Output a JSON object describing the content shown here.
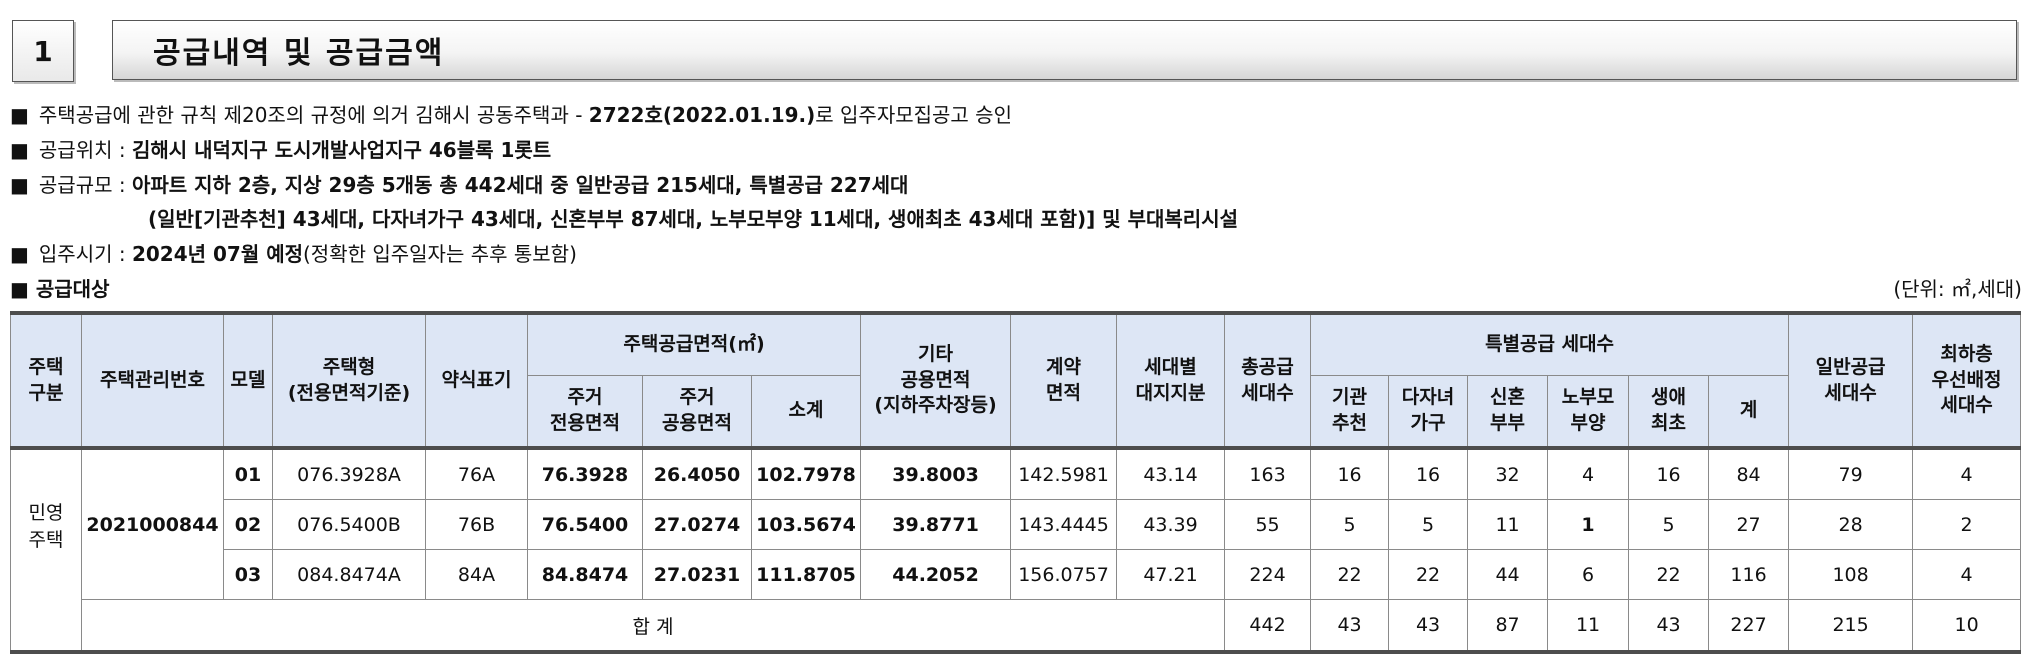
{
  "section": {
    "number": "1",
    "title": "공급내역 및 공급금액"
  },
  "notice": {
    "bullet": "■",
    "approval_prefix": "주택공급에 관한 규칙 제20조의 규정에 의거 김해시 공동주택과 -",
    "approval_no": "2722호(2022.01.19.)",
    "approval_suffix": "로 입주자모집공고 승인",
    "location_label": "공급위치 :",
    "location_value": "김해시 내덕지구 도시개발사업지구 46블록 1롯트",
    "scale_label": "공급규모 :",
    "scale_value": "아파트 지하 2층, 지상 29층 5개동 총 442세대 중 일반공급 215세대, 특별공급 227세대",
    "scale_detail": "(일반[기관추천] 43세대, 다자녀가구 43세대, 신혼부부 87세대, 노부모부양 11세대, 생애최초 43세대 포함)] 및 부대복리시설",
    "movein_label": "입주시기 :",
    "movein_value": "2024년 07월 예정",
    "movein_note": "(정확한 입주일자는 추후 통보함)",
    "target_label": "공급대상",
    "unit": "(단위:  ㎡,세대)"
  },
  "table": {
    "headers": {
      "type": [
        "주택",
        "구분"
      ],
      "mgmt_no": "주택관리번호",
      "model": "모델",
      "house_type": [
        "주택형",
        "(전용면적기준)"
      ],
      "short": "약식표기",
      "area_group": "주택공급면적(㎡)",
      "excl": [
        "주거",
        "전용면적"
      ],
      "common": [
        "주거",
        "공용면적"
      ],
      "subtotal": "소계",
      "other": [
        "기타",
        "공용면적",
        "(지하주차장등)"
      ],
      "contract": [
        "계약",
        "면적"
      ],
      "land": [
        "세대별",
        "대지지분"
      ],
      "total_units": [
        "총공급",
        "세대수"
      ],
      "special_group": "특별공급 세대수",
      "inst": [
        "기관",
        "추천"
      ],
      "multi": [
        "다자녀",
        "가구"
      ],
      "newlywed": [
        "신혼",
        "부부"
      ],
      "elderly": [
        "노부모",
        "부양"
      ],
      "first": [
        "생애",
        "최초"
      ],
      "special_sum": "계",
      "general": [
        "일반공급",
        "세대수"
      ],
      "lowest": [
        "최하층",
        "우선배정",
        "세대수"
      ]
    },
    "type_label": [
      "민영",
      "주택"
    ],
    "mgmt_no": "2021000844",
    "rows": [
      {
        "model": "01",
        "house_type": "076.3928A",
        "short": "76A",
        "excl": "76.3928",
        "common": "26.4050",
        "subtotal": "102.7978",
        "other": "39.8003",
        "contract": "142.5981",
        "land": "43.14",
        "total": "163",
        "inst": "16",
        "multi": "16",
        "newlywed": "32",
        "elderly": "4",
        "first": "16",
        "special_sum": "84",
        "general": "79",
        "lowest": "4"
      },
      {
        "model": "02",
        "house_type": "076.5400B",
        "short": "76B",
        "excl": "76.5400",
        "common": "27.0274",
        "subtotal": "103.5674",
        "other": "39.8771",
        "contract": "143.4445",
        "land": "43.39",
        "total": "55",
        "inst": "5",
        "multi": "5",
        "newlywed": "11",
        "elderly": "1",
        "first": "5",
        "special_sum": "27",
        "general": "28",
        "lowest": "2"
      },
      {
        "model": "03",
        "house_type": "084.8474A",
        "short": "84A",
        "excl": "84.8474",
        "common": "27.0231",
        "subtotal": "111.8705",
        "other": "44.2052",
        "contract": "156.0757",
        "land": "47.21",
        "total": "224",
        "inst": "22",
        "multi": "22",
        "newlywed": "44",
        "elderly": "6",
        "first": "22",
        "special_sum": "116",
        "general": "108",
        "lowest": "4"
      }
    ],
    "total": {
      "label": "합 계",
      "total": "442",
      "inst": "43",
      "multi": "43",
      "newlywed": "87",
      "elderly": "11",
      "first": "43",
      "special_sum": "227",
      "general": "215",
      "lowest": "10"
    }
  }
}
